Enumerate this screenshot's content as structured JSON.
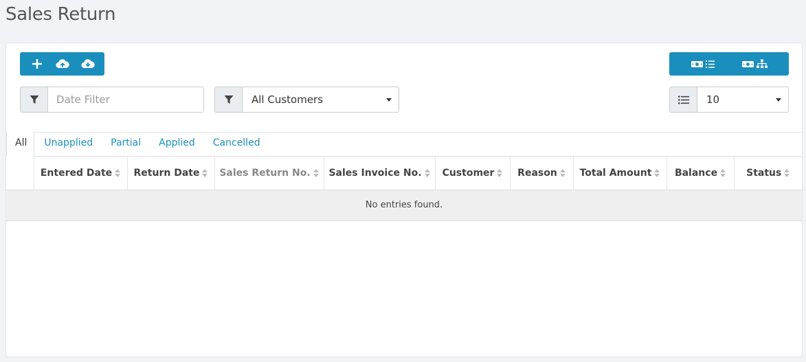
{
  "page": {
    "title": "Sales Return"
  },
  "toolbar": {
    "left_buttons": [
      {
        "icon": "plus-icon"
      },
      {
        "icon": "cloud-upload-icon"
      },
      {
        "icon": "cloud-download-icon"
      }
    ],
    "right_buttons": [
      {
        "icon": "money-list-icon"
      },
      {
        "icon": "money-sitemap-icon"
      }
    ],
    "accent_color": "#1a8fbd"
  },
  "filters": {
    "date": {
      "placeholder": "Date Filter",
      "value": ""
    },
    "customer": {
      "selected": "All Customers"
    },
    "per_page": {
      "selected": "10"
    }
  },
  "tabs": [
    {
      "label": "All",
      "active": true
    },
    {
      "label": "Unapplied",
      "active": false
    },
    {
      "label": "Partial",
      "active": false
    },
    {
      "label": "Applied",
      "active": false
    },
    {
      "label": "Cancelled",
      "active": false
    }
  ],
  "table": {
    "columns": [
      {
        "label": ""
      },
      {
        "label": "Entered Date"
      },
      {
        "label": "Return Date"
      },
      {
        "label": "Sales Return No."
      },
      {
        "label": "Sales Invoice No."
      },
      {
        "label": "Customer"
      },
      {
        "label": "Reason"
      },
      {
        "label": "Total Amount"
      },
      {
        "label": "Balance"
      },
      {
        "label": "Status"
      }
    ],
    "empty_message": "No entries found."
  }
}
